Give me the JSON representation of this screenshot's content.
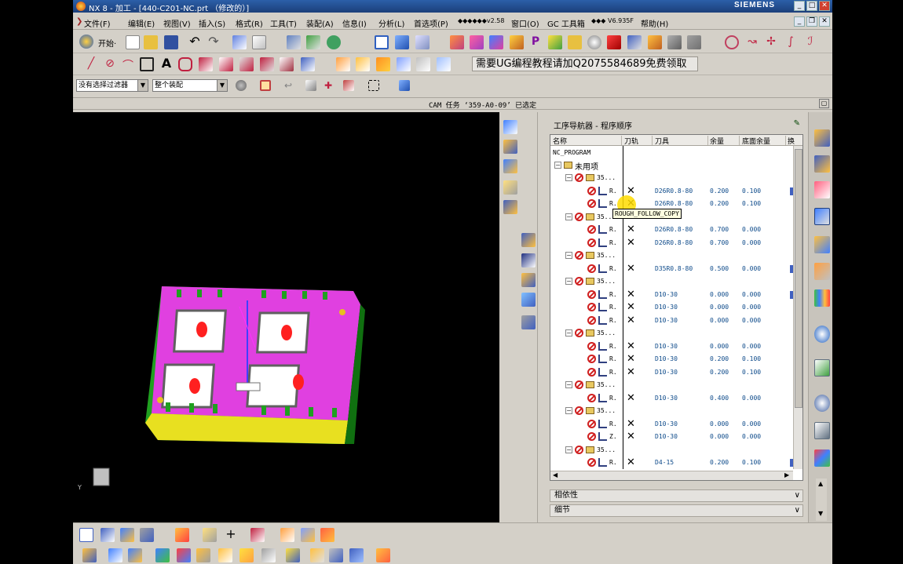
{
  "window": {
    "title": "NX 8 - 加工 - [440-C201-NC.prt （修改的）]",
    "brand": "SIEMENS"
  },
  "menu": [
    "文件(F)",
    "编辑(E)",
    "视图(V)",
    "插入(S)",
    "格式(R)",
    "工具(T)",
    "装配(A)",
    "信息(I)",
    "分析(L)",
    "首选项(P)",
    "◆◆◆◆◆◆v2.58",
    "窗口(O)",
    "GC 工具箱",
    "◆◆◆ V6.935F",
    "帮助(H)"
  ],
  "toolbar": {
    "start_label": "开始·"
  },
  "promo": "需要UG编程教程请加Q2075584689免费领取",
  "filters": {
    "type_filter": "没有选择过滤器",
    "scope_filter": "整个装配"
  },
  "status": "CAM 任务 ‘359-A0-09’ 已选定",
  "navigator": {
    "title": "工序导航器 - 程序顺序",
    "columns": [
      "名称",
      "刀轨",
      "刀具",
      "余量",
      "底面余量",
      "换"
    ],
    "root": "NC_PROGRAM",
    "unused": "未用项",
    "group_label": "35...",
    "op_label": "R.",
    "op_label_z": "Z.",
    "tooltip": "ROUGH_FOLLOW_COPY",
    "rows": [
      {
        "kind": "group"
      },
      {
        "kind": "op",
        "tool": "D26R0.8-80",
        "stock": "0.200",
        "floor": "0.100",
        "mark": true
      },
      {
        "kind": "op",
        "tool": "D26R0.8-80",
        "stock": "0.200",
        "floor": "0.100"
      },
      {
        "kind": "group"
      },
      {
        "kind": "op",
        "tool": "D26R0.8-80",
        "stock": "0.700",
        "floor": "0.000"
      },
      {
        "kind": "op",
        "tool": "D26R0.8-80",
        "stock": "0.700",
        "floor": "0.000"
      },
      {
        "kind": "group"
      },
      {
        "kind": "op",
        "tool": "D35R0.8-80",
        "stock": "0.500",
        "floor": "0.000",
        "mark": true
      },
      {
        "kind": "group"
      },
      {
        "kind": "op",
        "tool": "D10-30",
        "stock": "0.000",
        "floor": "0.000",
        "mark": true
      },
      {
        "kind": "op",
        "tool": "D10-30",
        "stock": "0.000",
        "floor": "0.000"
      },
      {
        "kind": "op",
        "tool": "D10-30",
        "stock": "0.000",
        "floor": "0.000"
      },
      {
        "kind": "group"
      },
      {
        "kind": "op",
        "tool": "D10-30",
        "stock": "0.000",
        "floor": "0.000"
      },
      {
        "kind": "op",
        "tool": "D10-30",
        "stock": "0.200",
        "floor": "0.100"
      },
      {
        "kind": "op",
        "tool": "D10-30",
        "stock": "0.200",
        "floor": "0.100"
      },
      {
        "kind": "group"
      },
      {
        "kind": "op",
        "tool": "D10-30",
        "stock": "0.400",
        "floor": "0.000"
      },
      {
        "kind": "group"
      },
      {
        "kind": "op",
        "tool": "D10-30",
        "stock": "0.000",
        "floor": "0.000"
      },
      {
        "kind": "op",
        "z": true,
        "tool": "D10-30",
        "stock": "0.000",
        "floor": "0.000"
      },
      {
        "kind": "group"
      },
      {
        "kind": "op",
        "tool": "D4-15",
        "stock": "0.200",
        "floor": "0.100",
        "mark": true
      }
    ],
    "sections": {
      "dependencies": "相依性",
      "details": "细节"
    }
  },
  "colors": {
    "accent": "#2c5fa8",
    "part_magenta": "#e040e0",
    "part_green": "#20a020",
    "part_yellow": "#e8e020"
  }
}
